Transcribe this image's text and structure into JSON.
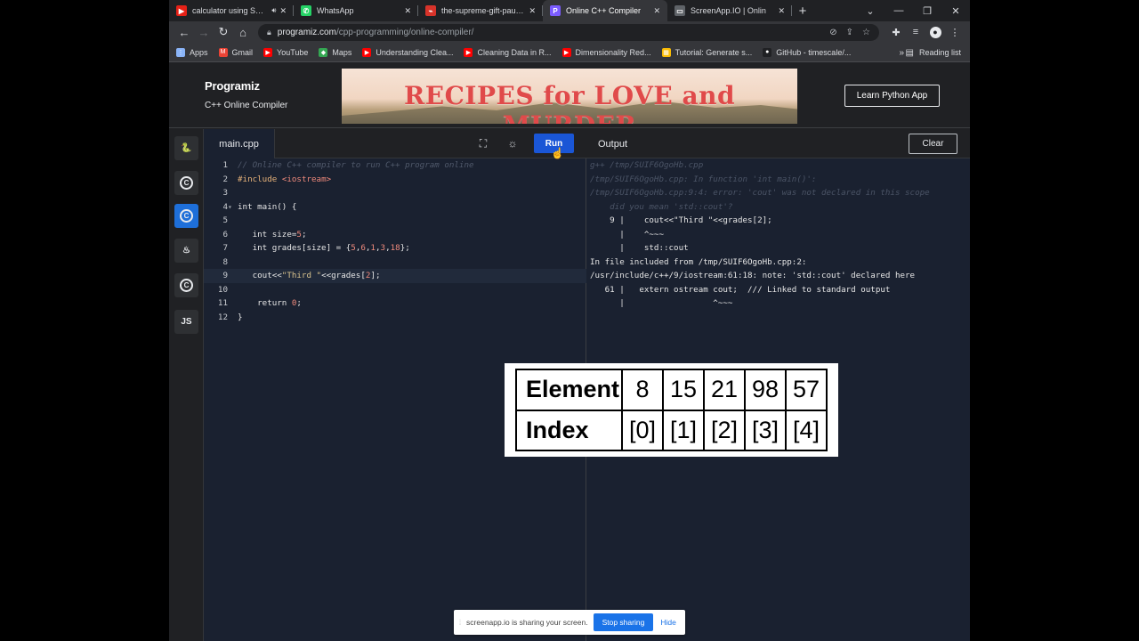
{
  "browser": {
    "tabs": [
      {
        "title": "calculator using Switc",
        "fav_color": "#e62117",
        "fav_glyph": "▶",
        "has_audio": true,
        "active": false
      },
      {
        "title": "WhatsApp",
        "fav_color": "#25d366",
        "fav_glyph": "✆",
        "has_audio": false,
        "active": false
      },
      {
        "title": "the-supreme-gift-paulo-c",
        "fav_color": "#d7332a",
        "fav_glyph": "⌁",
        "has_audio": false,
        "active": false
      },
      {
        "title": "Online C++ Compiler",
        "fav_color": "#7b5cff",
        "fav_glyph": "P",
        "has_audio": false,
        "active": true
      },
      {
        "title": "ScreenApp.IO | Onlin",
        "fav_color": "#5f6368",
        "fav_glyph": "▭",
        "has_audio": false,
        "active": false
      }
    ],
    "address": {
      "host": "programiz.com",
      "path": "/cpp-programming/online-compiler/"
    },
    "bookmarks": [
      {
        "label": "Apps",
        "fav_color": "#8ab4f8",
        "fav_glyph": "⋮"
      },
      {
        "label": "Gmail",
        "fav_color": "#ea4335",
        "fav_glyph": "M"
      },
      {
        "label": "YouTube",
        "fav_color": "#ff0000",
        "fav_glyph": "▶"
      },
      {
        "label": "Maps",
        "fav_color": "#34a853",
        "fav_glyph": "◆"
      },
      {
        "label": "Understanding Clea...",
        "fav_color": "#ff0000",
        "fav_glyph": "▶"
      },
      {
        "label": "Cleaning Data in R...",
        "fav_color": "#ff0000",
        "fav_glyph": "▶"
      },
      {
        "label": "Dimensionality Red...",
        "fav_color": "#ff0000",
        "fav_glyph": "▶"
      },
      {
        "label": "Tutorial: Generate s...",
        "fav_color": "#fbbc04",
        "fav_glyph": "▦"
      },
      {
        "label": "GitHub - timescale/...",
        "fav_color": "#202124",
        "fav_glyph": "●"
      }
    ],
    "reading_list": "Reading list"
  },
  "site": {
    "logo": "Programiz",
    "subtitle": "C++ Online Compiler",
    "ad_text": "RECIPES for LOVE and MURDER",
    "learn_button": "Learn Python App"
  },
  "sidebar": {
    "languages": [
      {
        "name": "python-icon",
        "glyph": "🐍",
        "active": false
      },
      {
        "name": "c-icon",
        "glyph": "C",
        "active": false
      },
      {
        "name": "cpp-icon",
        "glyph": "C",
        "active": true
      },
      {
        "name": "java-icon",
        "glyph": "♨",
        "active": false
      },
      {
        "name": "csharp-icon",
        "glyph": "C",
        "active": false
      },
      {
        "name": "js-icon",
        "glyph": "JS",
        "active": false
      }
    ]
  },
  "editor": {
    "filename": "main.cpp",
    "run_label": "Run",
    "lines": [
      {
        "n": "1",
        "code": "// Online C++ compiler to run C++ program online"
      },
      {
        "n": "2",
        "code": "#include <iostream>"
      },
      {
        "n": "3",
        "code": ""
      },
      {
        "n": "4",
        "code": "int main() {"
      },
      {
        "n": "5",
        "code": ""
      },
      {
        "n": "6",
        "code": "   int size=5;"
      },
      {
        "n": "7",
        "code": "   int grades[size] = {5,6,1,3,18};"
      },
      {
        "n": "8",
        "code": ""
      },
      {
        "n": "9",
        "code": "   cout<<\"Third \"<<grades[2];"
      },
      {
        "n": "10",
        "code": ""
      },
      {
        "n": "11",
        "code": "    return 0;"
      },
      {
        "n": "12",
        "code": "}"
      }
    ]
  },
  "output": {
    "title": "Output",
    "clear_label": "Clear",
    "lines": [
      {
        "text": "g++ /tmp/SUIF6OgoHb.cpp",
        "faint": true
      },
      {
        "text": "/tmp/SUIF6OgoHb.cpp: In function 'int main()':",
        "faint": true
      },
      {
        "text": "/tmp/SUIF6OgoHb.cpp:9:4: error: 'cout' was not declared in this scope",
        "faint": true
      },
      {
        "text": "    did you mean 'std::cout'?",
        "faint": true
      },
      {
        "text": "    9 |    cout<<\"Third \"<<grades[2];",
        "faint": false
      },
      {
        "text": "      |    ^~~~",
        "faint": false
      },
      {
        "text": "      |    std::cout",
        "faint": false
      },
      {
        "text": "In file included from /tmp/SUIF6OgoHb.cpp:2:",
        "faint": false
      },
      {
        "text": "/usr/include/c++/9/iostream:61:18: note: 'std::cout' declared here",
        "faint": false
      },
      {
        "text": "   61 |   extern ostream cout;  /// Linked to standard output",
        "faint": false
      },
      {
        "text": "      |                  ^~~~",
        "faint": false
      }
    ]
  },
  "overlay_table": {
    "rows": [
      {
        "header": "Element",
        "cells": [
          "8",
          "15",
          "21",
          "98",
          "57"
        ]
      },
      {
        "header": "Index",
        "cells": [
          "[0]",
          "[1]",
          "[2]",
          "[3]",
          "[4]"
        ]
      }
    ]
  },
  "share_bar": {
    "message": "screenapp.io is sharing your screen.",
    "stop_label": "Stop sharing",
    "hide_label": "Hide"
  }
}
